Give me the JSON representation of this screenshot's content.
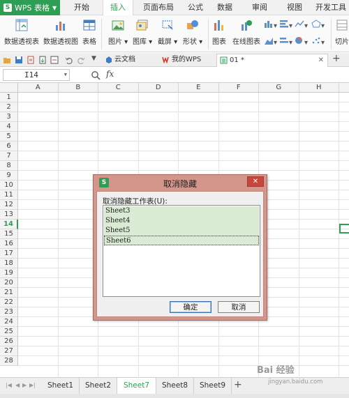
{
  "menubar": {
    "app_name": "WPS 表格",
    "logo_glyph": "S",
    "tabs": [
      "开始",
      "插入",
      "页面布局",
      "公式",
      "数据",
      "审阅",
      "视图",
      "开发工具"
    ],
    "active_tab": "插入"
  },
  "ribbon": {
    "buttons": [
      "数据透视表",
      "数据透视图",
      "表格",
      "图片",
      "图库",
      "截屏",
      "形状",
      "图表",
      "在线图表",
      "切片"
    ],
    "dropdown_buttons": [
      "图片",
      "图库",
      "截屏",
      "形状"
    ]
  },
  "quickbar": {
    "doc_tabs": [
      {
        "label": "云文档",
        "icon": "cloud-doc-icon"
      },
      {
        "label": "我的WPS",
        "icon": "wps-home-icon"
      },
      {
        "label": "01 *",
        "icon": "sheet-doc-icon",
        "active": true
      }
    ],
    "add_tab_glyph": "+"
  },
  "formula_bar": {
    "name_box": "I14",
    "fx_label": "fx"
  },
  "grid": {
    "columns": [
      "A",
      "B",
      "C",
      "D",
      "E",
      "F",
      "G",
      "H"
    ],
    "rows": [
      "1",
      "2",
      "3",
      "4",
      "5",
      "6",
      "7",
      "8",
      "9",
      "10",
      "11",
      "12",
      "13",
      "14",
      "15",
      "16",
      "17",
      "18",
      "19",
      "20",
      "21",
      "22",
      "23",
      "24",
      "25",
      "26",
      "27",
      "28"
    ],
    "selected_row": "14"
  },
  "sheets": {
    "tabs": [
      "Sheet1",
      "Sheet2",
      "Sheet7",
      "Sheet8",
      "Sheet9"
    ],
    "active": "Sheet7",
    "add_glyph": "+"
  },
  "dialog": {
    "title": "取消隐藏",
    "logo_glyph": "S",
    "close_glyph": "✕",
    "list_label": "取消隐藏工作表(U):",
    "items": [
      "Sheet3",
      "Sheet4",
      "Sheet5",
      "Sheet6"
    ],
    "ok_label": "确定",
    "cancel_label": "取消"
  },
  "watermark": {
    "text": "Bai 经验",
    "url": "jingyan.baidu.com"
  },
  "colors": {
    "accent": "#2f9e55",
    "dialog_frame": "#d4968b",
    "close_button": "#c9463d",
    "list_highlight": "#d9ebd3"
  }
}
